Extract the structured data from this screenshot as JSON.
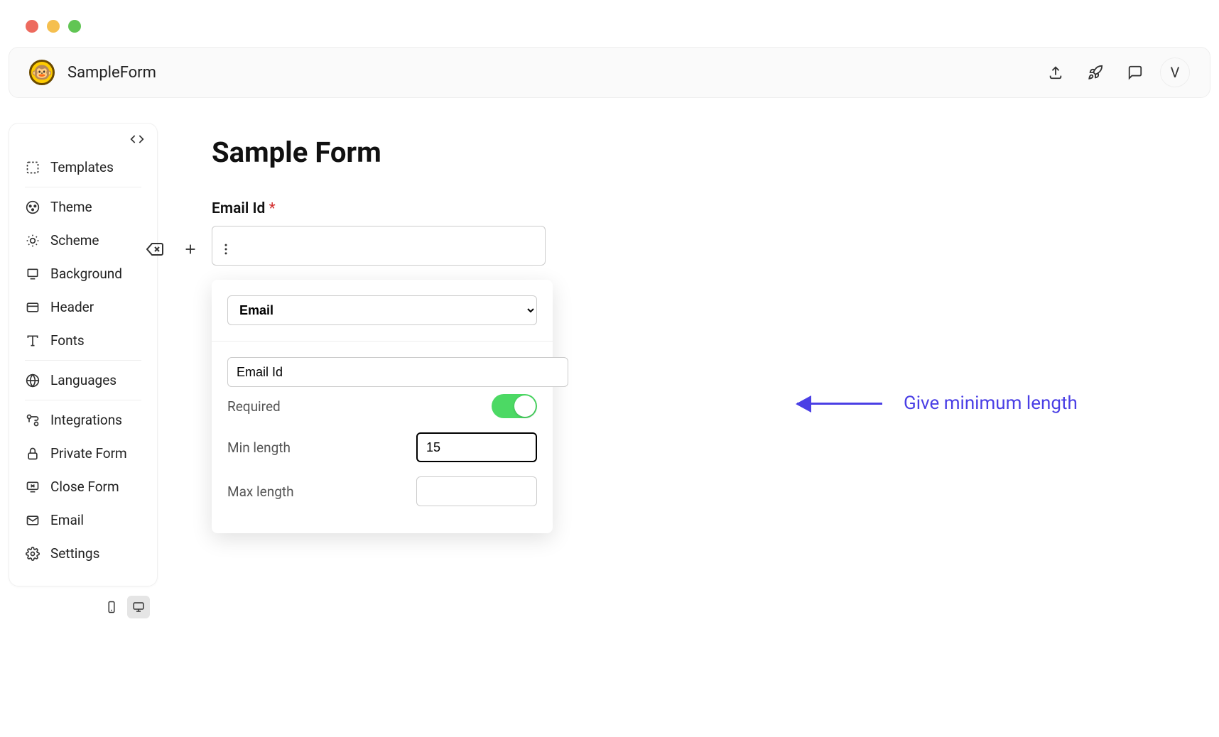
{
  "topbar": {
    "title": "SampleForm",
    "avatar_letter": "V"
  },
  "sidebar": {
    "items": [
      {
        "label": "Templates",
        "icon": "templates"
      },
      {
        "label": "Theme",
        "icon": "palette"
      },
      {
        "label": "Scheme",
        "icon": "sun"
      },
      {
        "label": "Background",
        "icon": "background"
      },
      {
        "label": "Header",
        "icon": "header"
      },
      {
        "label": "Fonts",
        "icon": "text"
      },
      {
        "label": "Languages",
        "icon": "globe"
      },
      {
        "label": "Integrations",
        "icon": "integrations"
      },
      {
        "label": "Private Form",
        "icon": "lock"
      },
      {
        "label": "Close Form",
        "icon": "close-display"
      },
      {
        "label": "Email",
        "icon": "mail"
      },
      {
        "label": "Settings",
        "icon": "gear"
      }
    ]
  },
  "form": {
    "title": "Sample Form",
    "field_label": "Email Id",
    "required_mark": "*",
    "field_value": ""
  },
  "popover": {
    "type_select": "Email",
    "name_value": "Email Id",
    "required_label": "Required",
    "required_on": true,
    "min_length_label": "Min length",
    "min_length_value": "15",
    "max_length_label": "Max length",
    "max_length_value": ""
  },
  "annotation": {
    "text": "Give minimum length"
  }
}
